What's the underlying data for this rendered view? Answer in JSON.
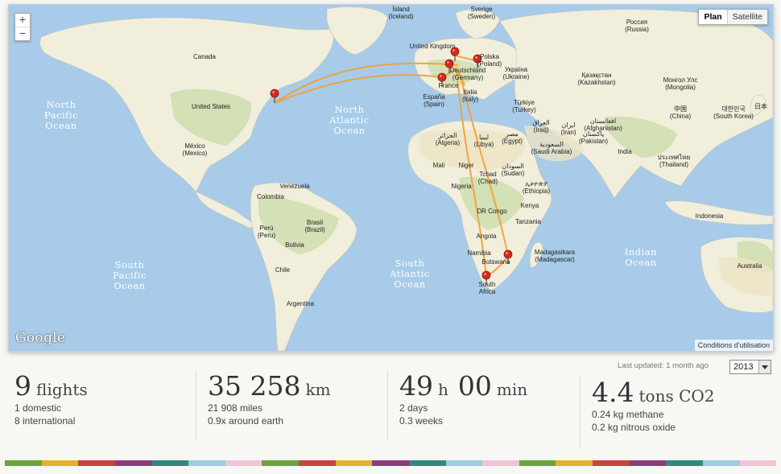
{
  "map": {
    "zoom_in": "+",
    "zoom_out": "−",
    "type_plan": "Plan",
    "type_satellite": "Satellite",
    "logo": "Google",
    "terms": "Conditions d'utilisation",
    "oceans": [
      {
        "lines": [
          "North",
          "Pacific",
          "Ocean"
        ]
      },
      {
        "lines": [
          "North",
          "Atlantic",
          "Ocean"
        ]
      },
      {
        "lines": [
          "South",
          "Pacific",
          "Ocean"
        ]
      },
      {
        "lines": [
          "South",
          "Atlantic",
          "Ocean"
        ]
      },
      {
        "lines": [
          "Indian",
          "Ocean"
        ]
      }
    ],
    "countries": [
      "Canada",
      "United States",
      "México",
      "(Mexico)",
      "Venezuela",
      "Colombia",
      "Brasil",
      "(Brazil)",
      "Perú",
      "(Peru)",
      "Bolivia",
      "Chile",
      "Argentina",
      "Ísland",
      "(Iceland)",
      "Sverige",
      "(Sweden)",
      "Россия",
      "(Russia)",
      "United Kingdom",
      "Deutschland",
      "(Germany)",
      "Polska",
      "(Poland)",
      "Україна",
      "(Ukraine)",
      "France",
      "España",
      "(Spain)",
      "Italia",
      "(Italy)",
      "Türkiye",
      "(Turkey)",
      "Қазақстан",
      "(Kazakhstan)",
      "Монгол Улс",
      "(Mongolia)",
      "中国",
      "(China)",
      "대한민국",
      "(South Korea)",
      "日本",
      "الجزائر",
      "(Algeria)",
      "ليبيا",
      "(Libya)",
      "مصر",
      "(Egypt)",
      "العراق",
      "(Iraq)",
      "ایران",
      "(Iran)",
      "افغانستان",
      "(Afghanistan)",
      "پاکستان",
      "(Pakistan)",
      "India",
      "السعودية",
      "(Saudi Arabia)",
      "ประเทศไทย",
      "(Thailand)",
      "Mali",
      "Niger",
      "Tchad",
      "(Chad)",
      "السودان",
      "(Sudan)",
      "Nigeria",
      "ኢትዮጵያ",
      "(Ethiopia)",
      "DR Congo",
      "Kenya",
      "Tanzania",
      "Angola",
      "Namibia",
      "Botswana",
      "South",
      "Africa",
      "Madagasikara",
      "(Madagascar)",
      "Indonesia",
      "Australia"
    ],
    "route_color": "#f0a23a",
    "pin_color": "#d42a1e"
  },
  "last_updated": "Last updated: 1 month ago",
  "year": "2013",
  "stats": [
    {
      "value": "9",
      "unit": "flights",
      "lines": [
        "1 domestic",
        "8 international"
      ]
    },
    {
      "value": "35 258",
      "unit": "km",
      "lines": [
        "21 908 miles",
        "0.9x around earth"
      ]
    },
    {
      "value": "49",
      "unit": "h",
      "value2": "00",
      "unit2": "min",
      "lines": [
        "2 days",
        "0.3 weeks"
      ]
    },
    {
      "value": "4.4",
      "unit": "tons CO2",
      "lines": [
        "0.24 kg methane",
        "0.2 kg nitrous oxide"
      ]
    }
  ],
  "stripe_colors": [
    "#6aa339",
    "#e6b12a",
    "#c4443f",
    "#8e3a7a",
    "#2f8a77",
    "#9ecae0",
    "#f0c3d6",
    "#6aa339",
    "#c4443f",
    "#e6b12a",
    "#8e3a7a",
    "#2f8a77",
    "#9ecae0",
    "#f0c3d6",
    "#6aa339",
    "#e6b12a",
    "#c4443f",
    "#8e3a7a",
    "#2f8a77",
    "#9ecae0",
    "#f0c3d6"
  ]
}
